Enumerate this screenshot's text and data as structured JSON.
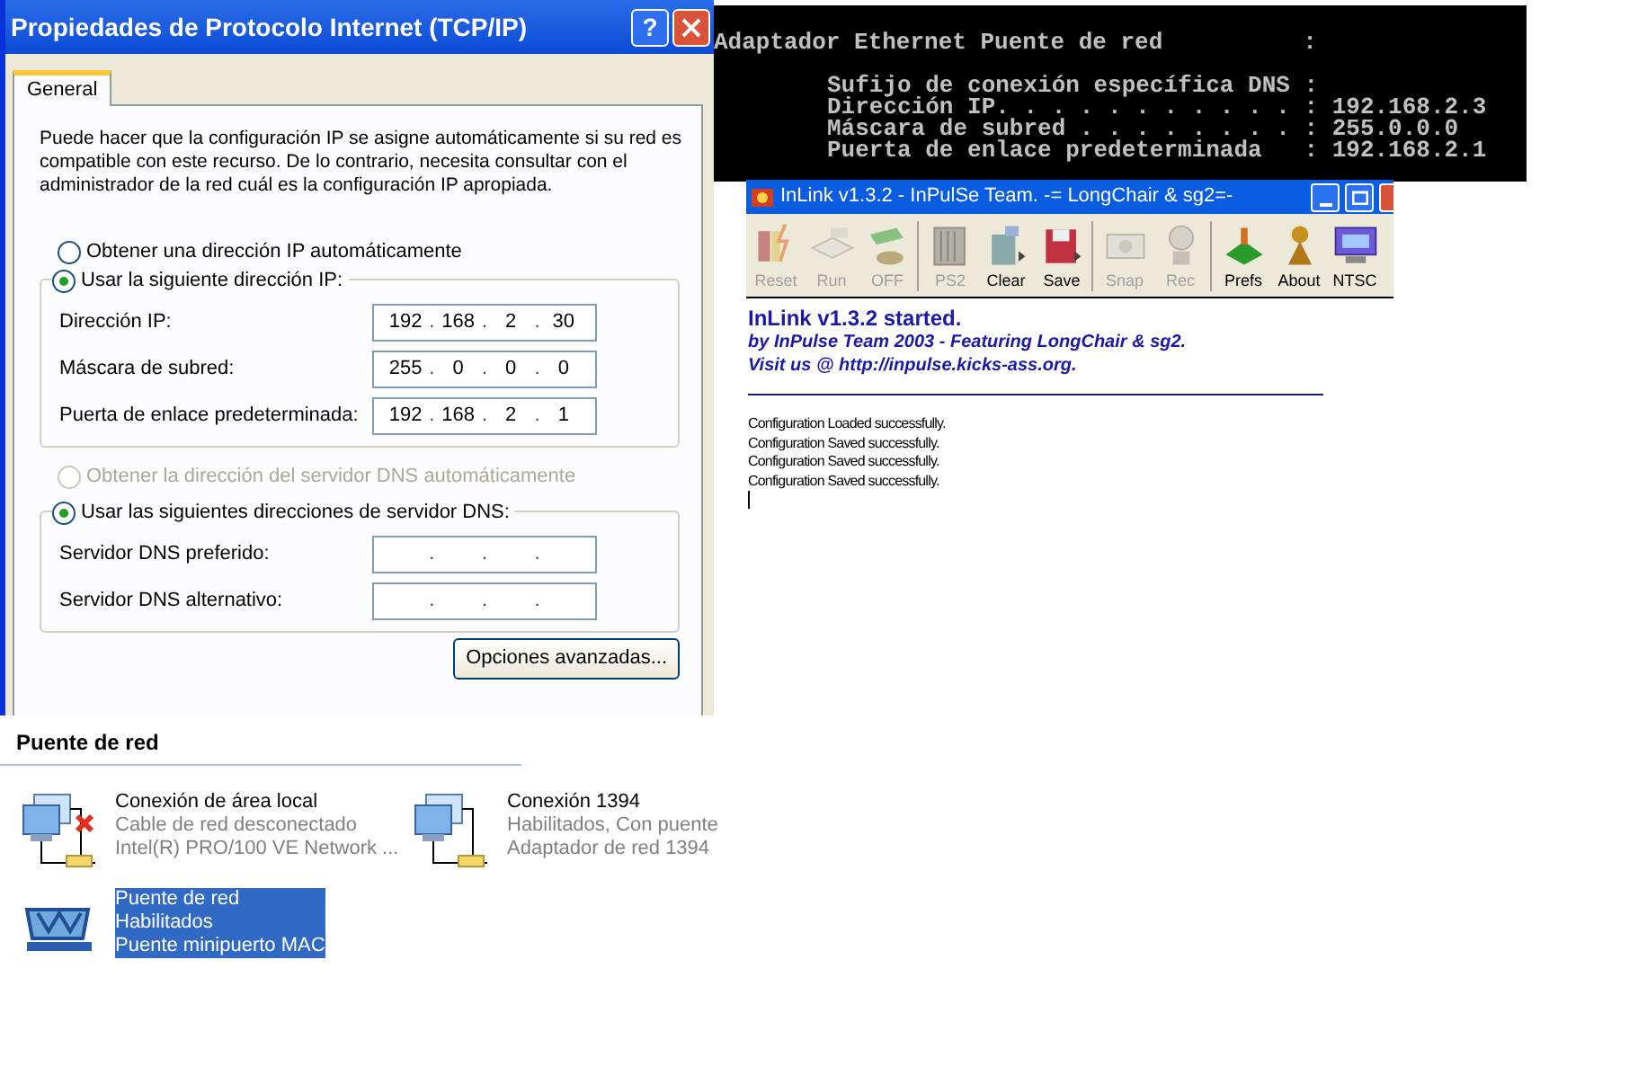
{
  "dialog": {
    "title": "Propiedades de Protocolo Internet (TCP/IP)",
    "help_button": "?",
    "tabs": [
      {
        "label": "General",
        "selected": true
      }
    ],
    "intro": "Puede hacer que la configuración IP se asigne automáticamente si su red es compatible con este recurso. De lo contrario, necesita consultar con el administrador de la red cuál es la configuración IP apropiada.",
    "separator": ".",
    "ip_options": [
      {
        "label": "Obtener una dirección IP automáticamente",
        "selected": false,
        "disabled": false
      },
      {
        "label": "Usar la siguiente dirección IP:",
        "selected": true,
        "disabled": false
      }
    ],
    "ip_fields": [
      {
        "label": "Dirección IP:",
        "octets": [
          "192",
          "168",
          "2",
          "30"
        ]
      },
      {
        "label": "Máscara de subred:",
        "octets": [
          "255",
          "0",
          "0",
          "0"
        ]
      },
      {
        "label": "Puerta de enlace predeterminada:",
        "octets": [
          "192",
          "168",
          "2",
          "1"
        ]
      }
    ],
    "dns_options": [
      {
        "label": "Obtener la dirección del servidor DNS automáticamente",
        "selected": false,
        "disabled": true
      },
      {
        "label": "Usar las siguientes direcciones de servidor DNS:",
        "selected": true,
        "disabled": false
      }
    ],
    "dns_fields": [
      {
        "label": "Servidor DNS preferido:"
      },
      {
        "label": "Servidor DNS alternativo:"
      }
    ],
    "advanced_button": "Opciones avanzadas..."
  },
  "network": {
    "heading": "Puente de red",
    "items": [
      {
        "name": "Conexión de área local",
        "status": "Cable de red desconectado",
        "device": "Intel(R) PRO/100 VE Network ...",
        "disconnected": true,
        "selected": false
      },
      {
        "name": "Conexión 1394",
        "status": "Habilitados, Con puente",
        "device": "Adaptador de red 1394",
        "disconnected": false,
        "selected": false
      },
      {
        "name": "Puente de red",
        "status": "Habilitados",
        "device": "Puente minipuerto MAC",
        "disconnected": false,
        "selected": true
      }
    ]
  },
  "console": {
    "header": "Adaptador Ethernet Puente de red          :",
    "entries": [
      "Sufijo de conexión específica DNS :",
      "Dirección IP. . . . . . . . . . . : 192.168.2.3",
      "Máscara de subred . . . . . . . . : 255.0.0.0",
      "Puerta de enlace predeterminada   : 192.168.2.1"
    ]
  },
  "inlink": {
    "title": "InLink v1.3.2 - InPulSe Team. -= LongChair & sg2=-",
    "toolbar": [
      {
        "label": "Reset",
        "disabled": true
      },
      {
        "label": "Run",
        "disabled": true
      },
      {
        "label": "OFF",
        "disabled": true
      },
      {
        "label": "PS2",
        "disabled": true
      },
      {
        "label": "Clear",
        "disabled": false
      },
      {
        "label": "Save",
        "disabled": false
      },
      {
        "label": "Snap",
        "disabled": true
      },
      {
        "label": "Rec",
        "disabled": true
      },
      {
        "label": "Prefs",
        "disabled": false
      },
      {
        "label": "About",
        "disabled": false
      },
      {
        "label": "NTSC",
        "disabled": false
      }
    ],
    "started": "InLink v1.3.2 started.",
    "credits": [
      "by InPulse Team 2003 - Featuring LongChair & sg2.",
      "Visit us @ http://inpulse.kicks-ass.org."
    ],
    "log": [
      "Configuration Loaded successfully.",
      "Configuration Saved successfully.",
      "Configuration Saved successfully.",
      "Configuration Saved successfully."
    ]
  }
}
